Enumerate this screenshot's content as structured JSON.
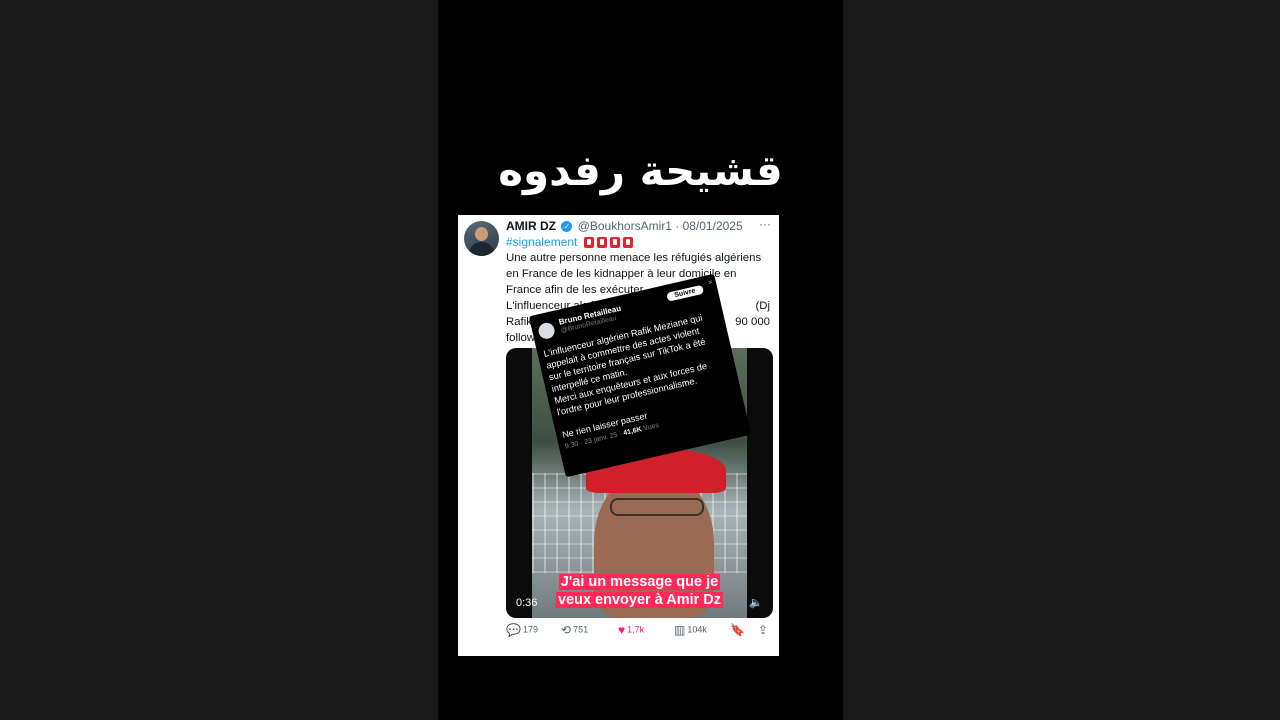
{
  "caption": "قشيحة رفدوه",
  "tweet": {
    "name": "AMIR DZ",
    "handle": "@BoukhorsAmir1",
    "date": "· 08/01/2025",
    "more": "···",
    "hashtag": "#signalement",
    "lines": [
      "Une autre personne menace les réfugiés algériens",
      "en France de les kidnapper à leur domicile en",
      "France afin de les exécuter.",
      "L'influenceur algérien",
      "Rafik ),",
      "follow"
    ],
    "line4_tail": "(Dj",
    "line5_tail": "90 000",
    "video": {
      "subtitle_1": "J'ai un message que je",
      "subtitle_2": "veux envoyer à Amir Dz",
      "time": "0:36",
      "volume_icon": "speaker-icon"
    },
    "actions": {
      "replies": "179",
      "reposts": "751",
      "likes": "1,7k",
      "views": "104k"
    },
    "colors": {
      "accent": "#1d9bf0",
      "like": "#f91880",
      "subtitle_bg": "#ff2a57"
    }
  },
  "overlay": {
    "name": "Bruno Retailleau",
    "handle": "@BrunoRetailleau",
    "follow_label": "Suivre",
    "close": "×",
    "lines": [
      "L'influenceur algérien Rafik Meziane qui",
      "appelait à commettre des actes violent",
      "sur le territoire français sur TikTok a été",
      "interpellé ce matin.",
      "Merci aux enquêteurs et aux forces de",
      "l'ordre pour leur professionnalisme."
    ],
    "tagline": "Ne rien laisser passer",
    "meta": "9:30 · 23 janv. 25 ·",
    "views": "41,6K",
    "views_label": "Vues"
  }
}
